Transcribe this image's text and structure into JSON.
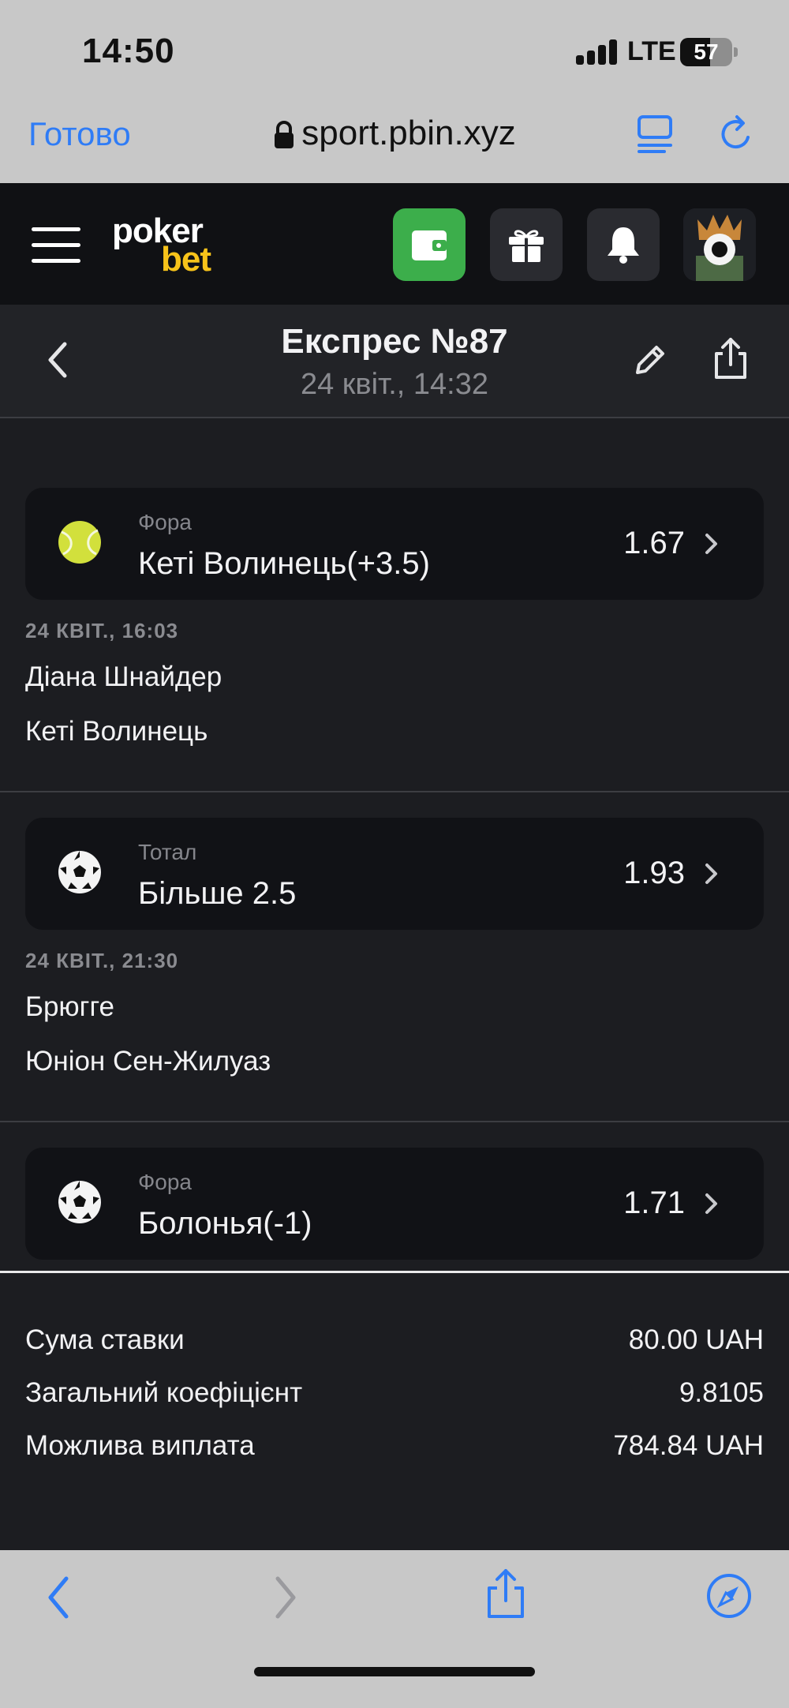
{
  "status_bar": {
    "time": "14:50",
    "network": "LTE",
    "battery": "57"
  },
  "browser": {
    "done_label": "Готово",
    "url": "sport.pbin.xyz"
  },
  "header": {
    "logo_top": "poker",
    "logo_bottom": "bet",
    "wallet_color": "#3cae4b",
    "logo_accent": "#f7c31a"
  },
  "bet": {
    "title": "Експрес №87",
    "date": "24 квіт., 14:32"
  },
  "selections": [
    {
      "sport_icon": "tennis-ball-icon",
      "market": "Фора",
      "selection": "Кеті Волинець(+3.5)",
      "odds": "1.67",
      "event_time": "24 КВІТ., 16:03",
      "team1": "Діана Шнайдер",
      "team2": "Кеті Волинець"
    },
    {
      "sport_icon": "soccer-ball-icon",
      "market": "Тотал",
      "selection": "Більше 2.5",
      "odds": "1.93",
      "event_time": "24 КВІТ., 21:30",
      "team1": "Брюгге",
      "team2": "Юніон Сен-Жилуаз"
    },
    {
      "sport_icon": "soccer-ball-icon",
      "market": "Фора",
      "selection": "Болонья(-1)",
      "odds": "1.71"
    }
  ],
  "summary": {
    "stake_label": "Сума ставки",
    "stake_value": "80.00 UAH",
    "total_odds_label": "Загальний коефіцієнт",
    "total_odds_value": "9.8105",
    "payout_label": "Можлива виплата",
    "payout_value": "784.84 UAH"
  }
}
